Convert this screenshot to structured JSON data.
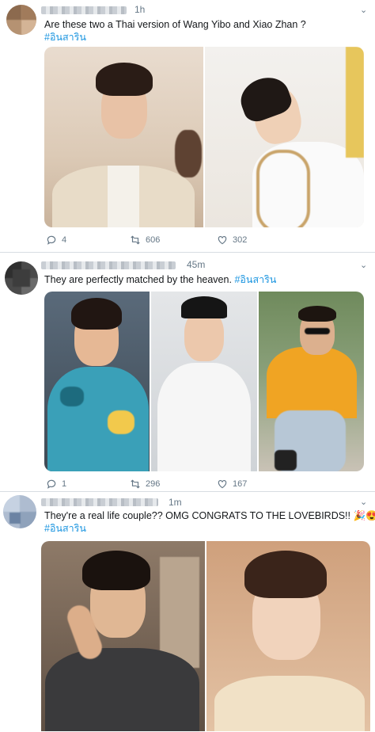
{
  "tweets": [
    {
      "time": "1h",
      "text": "Are these two a Thai version of Wang Yibo and Xiao Zhan ?",
      "hashtag": "#อินสาริน",
      "replies": "4",
      "retweets": "606",
      "likes": "302"
    },
    {
      "time": "45m",
      "text": "They are perfectly matched by the heaven.",
      "hashtag": "#อินสาริน",
      "replies": "1",
      "retweets": "296",
      "likes": "167"
    },
    {
      "time": "1m",
      "text": "They're a real life couple?? OMG CONGRATS TO THE LOVEBIRDS!! 🎉😍",
      "hashtag": "#อินสาริน"
    }
  ],
  "icons": {
    "reply": "reply-icon",
    "retweet": "retweet-icon",
    "like": "heart-icon",
    "more": "chevron-down-icon"
  },
  "colors": {
    "link": "#1b95e0",
    "meta": "#657786",
    "divider": "#d8dde2"
  }
}
